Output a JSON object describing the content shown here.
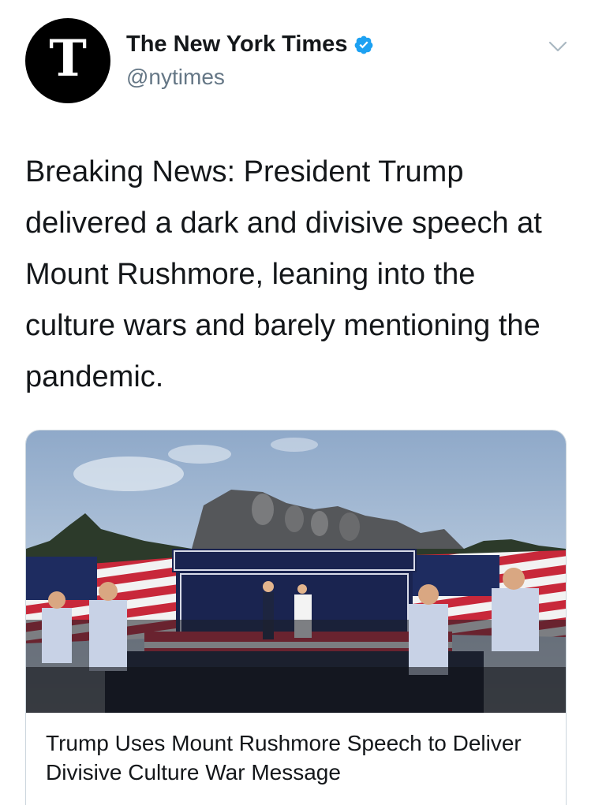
{
  "account": {
    "display_name": "The New York Times",
    "handle": "@nytimes",
    "avatar_glyph": "T",
    "verified": true
  },
  "tweet": {
    "text": "Breaking News: President Trump delivered a dark and divisive speech at Mount Rushmore, leaning into the culture wars and barely mentioning the pandemic."
  },
  "link_card": {
    "title": "Trump Uses Mount Rushmore Speech to Deliver Divisive Culture War Message"
  },
  "icons": {
    "verified": "verified-badge-icon",
    "menu": "chevron-down-icon"
  },
  "colors": {
    "verified_blue": "#1da1f2",
    "secondary_text": "#657786",
    "caret": "#aab8c2",
    "card_border": "#ccd6dd"
  }
}
